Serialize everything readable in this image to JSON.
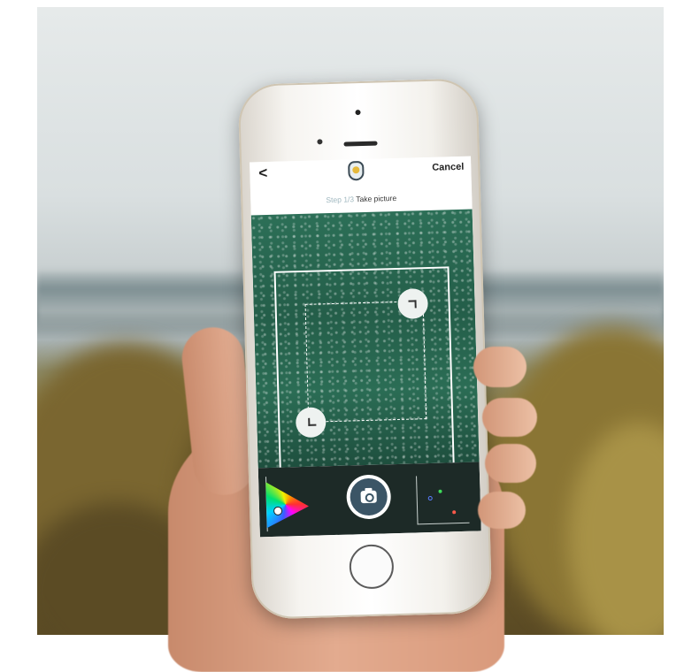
{
  "nav": {
    "back_label": "<",
    "cancel_label": "Cancel"
  },
  "step": {
    "number": "Step 1/3",
    "title": "Take picture"
  },
  "icons": {
    "back": "chevron-left-icon",
    "logo": "app-logo-icon",
    "shutter": "camera-icon",
    "color_wheel": "color-wheel-icon",
    "scatter": "scatter-plot-icon"
  },
  "colors": {
    "viewfinder_green": "#2c6f57",
    "bottom_bar": "#1d2a27",
    "shutter_fill": "#3b5566"
  }
}
